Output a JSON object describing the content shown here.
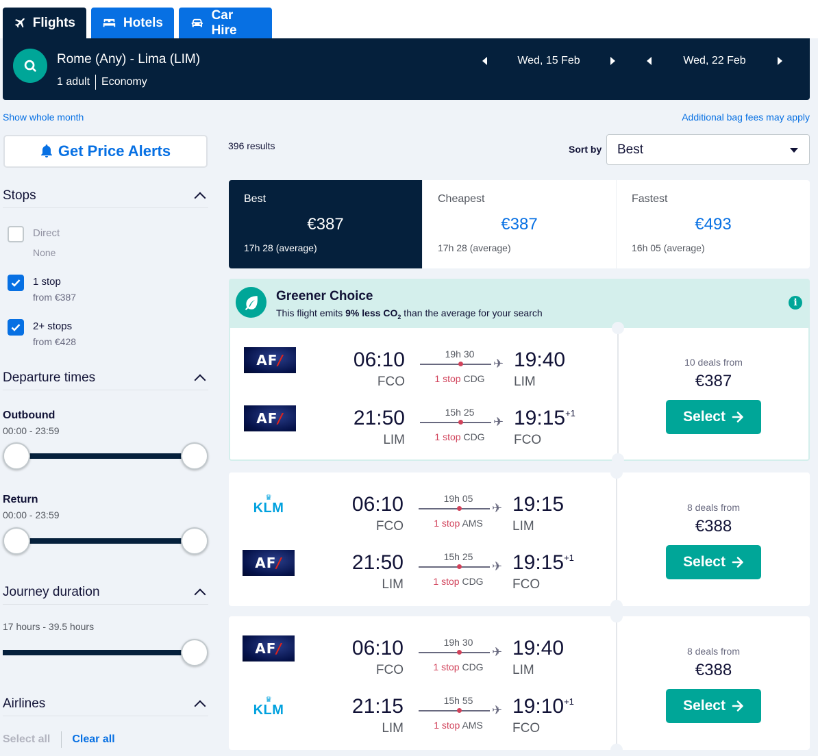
{
  "tabs": [
    {
      "label": "Flights"
    },
    {
      "label": "Hotels"
    },
    {
      "label": "Car Hire"
    }
  ],
  "search": {
    "route": "Rome (Any) - Lima (LIM)",
    "passengers": "1 adult",
    "cabin": "Economy",
    "depart_date": "Wed, 15 Feb",
    "return_date": "Wed, 22 Feb"
  },
  "links": {
    "show_month": "Show whole month",
    "bag_fees": "Additional bag fees may apply"
  },
  "sidebar": {
    "price_alerts": "Get Price Alerts",
    "stops": {
      "title": "Stops",
      "options": [
        {
          "label": "Direct",
          "sub": "None",
          "checked": false
        },
        {
          "label": "1 stop",
          "sub": "from €387",
          "checked": true
        },
        {
          "label": "2+ stops",
          "sub": "from €428",
          "checked": true
        }
      ]
    },
    "departure": {
      "title": "Departure times",
      "outbound_label": "Outbound",
      "outbound_range": "00:00 - 23:59",
      "return_label": "Return",
      "return_range": "00:00 - 23:59"
    },
    "duration": {
      "title": "Journey duration",
      "range": "17 hours - 39.5 hours"
    },
    "airlines": {
      "title": "Airlines",
      "select_all": "Select all",
      "clear_all": "Clear all"
    }
  },
  "results": {
    "count": "396 results",
    "sort_label": "Sort by",
    "sort_value": "Best"
  },
  "sort_tabs": [
    {
      "name": "Best",
      "price": "€387",
      "avg": "17h 28 (average)"
    },
    {
      "name": "Cheapest",
      "price": "€387",
      "avg": "17h 28 (average)"
    },
    {
      "name": "Fastest",
      "price": "€493",
      "avg": "16h 05 (average)"
    }
  ],
  "greener": {
    "title": "Greener Choice",
    "text_before": "This flight emits ",
    "text_bold": "9% less CO",
    "text_sub": "2",
    "text_after": " than the average for your search"
  },
  "cards": [
    {
      "deals": "10 deals from",
      "price": "€387",
      "select": "Select",
      "legs": [
        {
          "airline": "AF",
          "dep_time": "06:10",
          "dep_ap": "FCO",
          "duration": "19h 30",
          "stop_count": "1 stop",
          "stop_ap": "CDG",
          "arr_time": "19:40",
          "arr_ap": "LIM",
          "plus": ""
        },
        {
          "airline": "AF",
          "dep_time": "21:50",
          "dep_ap": "LIM",
          "duration": "15h 25",
          "stop_count": "1 stop",
          "stop_ap": "CDG",
          "arr_time": "19:15",
          "arr_ap": "FCO",
          "plus": "+1"
        }
      ]
    },
    {
      "deals": "8 deals from",
      "price": "€388",
      "select": "Select",
      "legs": [
        {
          "airline": "KLM",
          "dep_time": "06:10",
          "dep_ap": "FCO",
          "duration": "19h 05",
          "stop_count": "1 stop",
          "stop_ap": "AMS",
          "arr_time": "19:15",
          "arr_ap": "LIM",
          "plus": ""
        },
        {
          "airline": "AF",
          "dep_time": "21:50",
          "dep_ap": "LIM",
          "duration": "15h 25",
          "stop_count": "1 stop",
          "stop_ap": "CDG",
          "arr_time": "19:15",
          "arr_ap": "FCO",
          "plus": "+1"
        }
      ]
    },
    {
      "deals": "8 deals from",
      "price": "€388",
      "select": "Select",
      "legs": [
        {
          "airline": "AF",
          "dep_time": "06:10",
          "dep_ap": "FCO",
          "duration": "19h 30",
          "stop_count": "1 stop",
          "stop_ap": "CDG",
          "arr_time": "19:40",
          "arr_ap": "LIM",
          "plus": ""
        },
        {
          "airline": "KLM",
          "dep_time": "21:15",
          "dep_ap": "LIM",
          "duration": "15h 55",
          "stop_count": "1 stop",
          "stop_ap": "AMS",
          "arr_time": "19:10",
          "arr_ap": "FCO",
          "plus": "+1"
        }
      ]
    }
  ],
  "colors": {
    "navy": "#05203c",
    "blue": "#0770e3",
    "teal": "#00a698",
    "stop_red": "#d1435b",
    "green_banner": "#d4efec"
  },
  "icons": {
    "flights": "plane-icon",
    "hotels": "bed-icon",
    "car_hire": "car-icon",
    "search": "search-icon",
    "alerts": "bell-icon",
    "greener": "leaf-icon",
    "info": "info-icon",
    "select": "arrow-right-icon"
  }
}
